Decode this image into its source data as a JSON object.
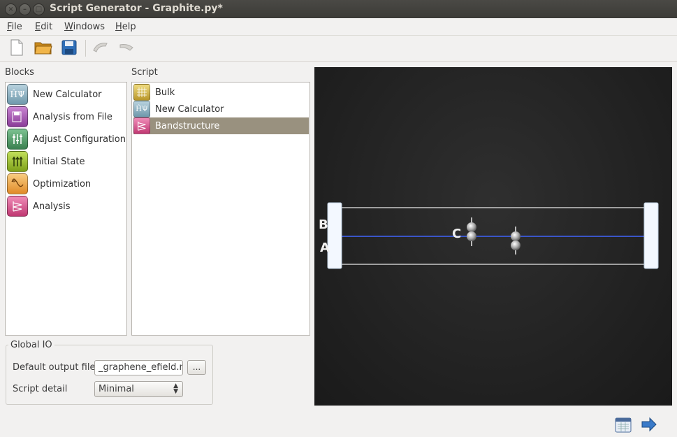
{
  "window": {
    "title": "Script Generator - Graphite.py*",
    "controls": [
      "close-icon",
      "minimize-icon",
      "maximize-icon"
    ]
  },
  "menu": {
    "file": "File",
    "edit": "Edit",
    "windows": "Windows",
    "help": "Help"
  },
  "toolbar": {
    "icons": [
      "new-file-icon",
      "open-folder-icon",
      "save-icon",
      "undo-icon",
      "redo-icon"
    ]
  },
  "blocks": {
    "label": "Blocks",
    "items": [
      {
        "label": "New Calculator",
        "icon": "calculator-hpsi-icon",
        "color": "#8fb3c4"
      },
      {
        "label": "Analysis from File",
        "icon": "analysis-file-icon",
        "color": "#a454b0"
      },
      {
        "label": "Adjust Configuration",
        "icon": "adjust-config-icon",
        "color": "#55a06a"
      },
      {
        "label": "Initial State",
        "icon": "initial-state-icon",
        "color": "#9cc02c"
      },
      {
        "label": "Optimization",
        "icon": "optimization-icon",
        "color": "#f0a44a"
      },
      {
        "label": "Analysis",
        "icon": "analysis-icon",
        "color": "#d8568c"
      }
    ]
  },
  "script": {
    "label": "Script",
    "items": [
      {
        "label": "Bulk",
        "icon": "bulk-icon",
        "color": "#d4b84a"
      },
      {
        "label": "New Calculator",
        "icon": "calculator-hpsi-icon",
        "color": "#8fb3c4"
      },
      {
        "label": "Bandstructure",
        "icon": "bandstructure-icon",
        "color": "#d8568c",
        "selected": true
      }
    ]
  },
  "global_io": {
    "title": "Global IO",
    "output_label": "Default output file",
    "output_value": "_graphene_efield.nc",
    "browse_label": "...",
    "detail_label": "Script detail",
    "detail_value": "Minimal"
  },
  "viewer": {
    "label_b": "B",
    "label_a": "A",
    "label_c": "C",
    "colors": {
      "background": "#222222",
      "axis_line": "#3a55c8",
      "cell_lines": "#c8c8c8"
    }
  },
  "bottom": {
    "icons": [
      "spreadsheet-icon",
      "forward-arrow-icon"
    ]
  }
}
